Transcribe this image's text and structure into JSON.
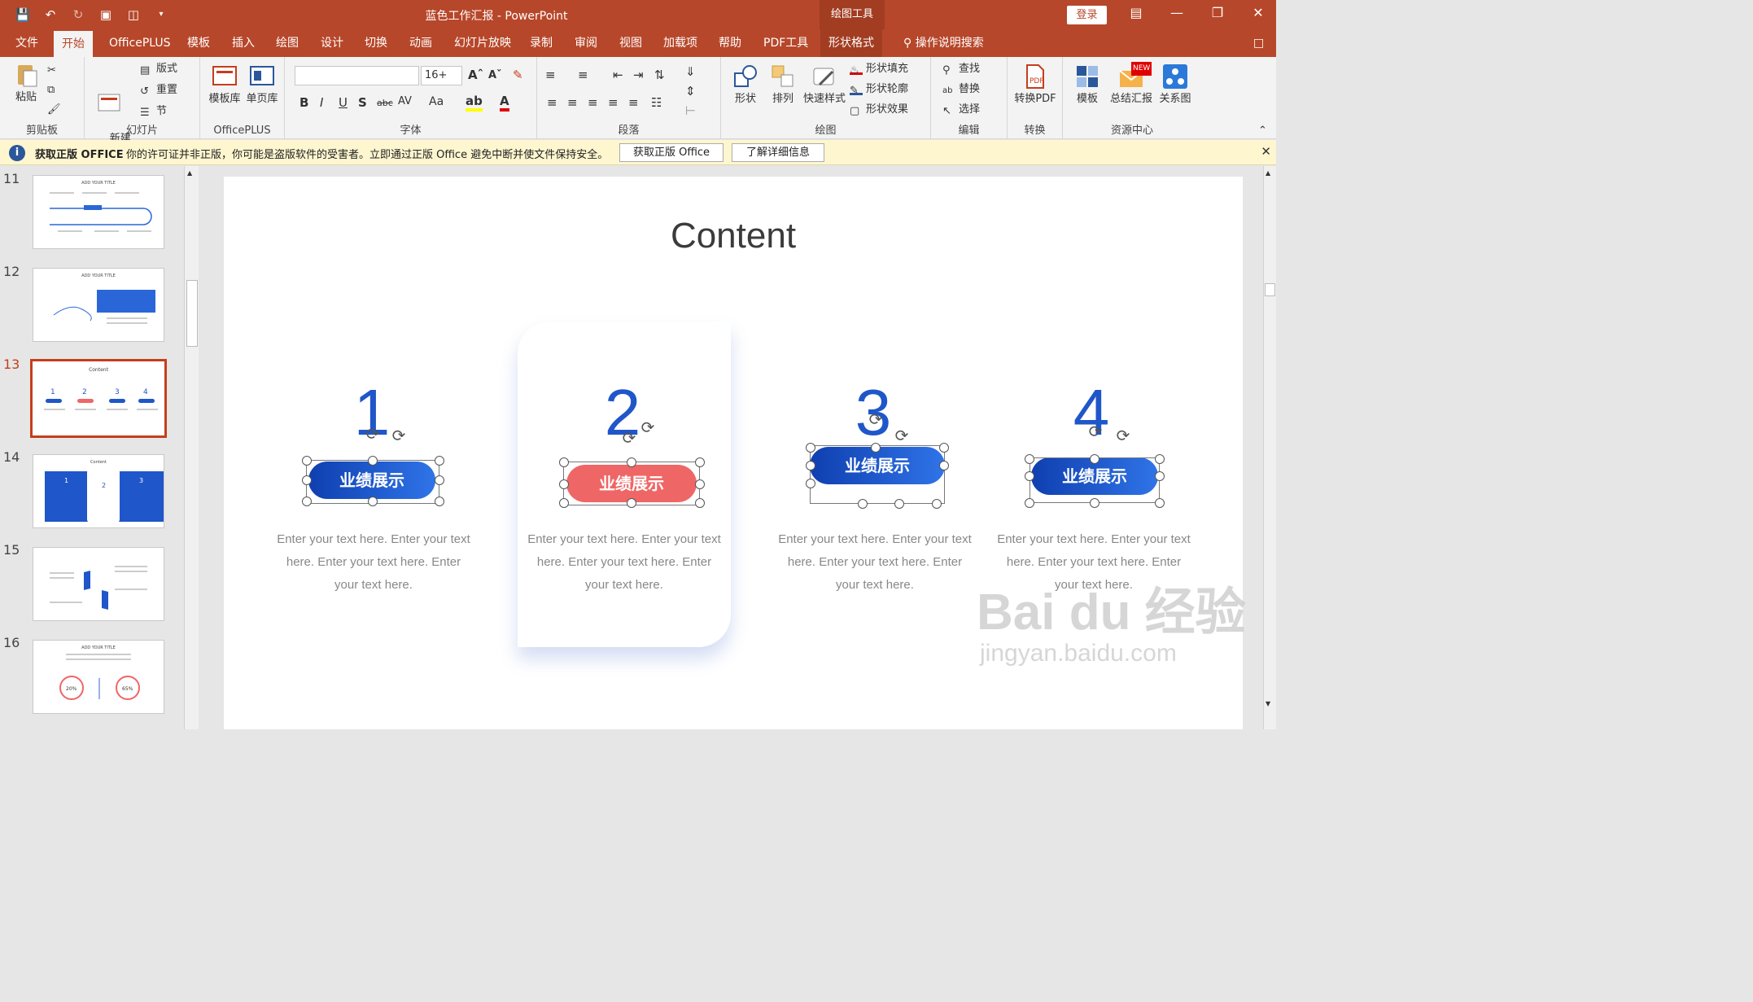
{
  "window": {
    "title": "蓝色工作汇报 - PowerPoint",
    "context_tab": "绘图工具",
    "login": "登录",
    "qat": [
      "save-icon",
      "undo-icon",
      "redo-icon",
      "present-icon",
      "layout-icon",
      "customize-icon"
    ],
    "controls": [
      "ribbon-display-icon",
      "minimize-icon",
      "maximize-icon",
      "close-icon"
    ]
  },
  "tabs": [
    "文件",
    "开始",
    "OfficePLUS",
    "模板",
    "插入",
    "绘图",
    "设计",
    "切换",
    "动画",
    "幻灯片放映",
    "录制",
    "审阅",
    "视图",
    "加载项",
    "帮助",
    "PDF工具",
    "形状格式"
  ],
  "tell_me": "操作说明搜索",
  "ribbon": {
    "clipboard": {
      "label": "剪贴板",
      "paste": "粘贴"
    },
    "slides": {
      "label": "幻灯片",
      "new_slide": "新建\n幻灯片",
      "layout": "版式",
      "reset": "重置",
      "section": "节"
    },
    "officeplus": {
      "label": "OfficePLUS",
      "lib": "模板库",
      "single": "单页库"
    },
    "font": {
      "label": "字体",
      "name": "",
      "size": "16+"
    },
    "paragraph": {
      "label": "段落"
    },
    "drawing": {
      "label": "绘图",
      "shape": "形状",
      "arrange": "排列",
      "quick_style": "快速样式",
      "fill": "形状填充",
      "outline": "形状轮廓",
      "effect": "形状效果"
    },
    "editing": {
      "label": "编辑",
      "find": "查找",
      "replace": "替换",
      "select": "选择"
    },
    "convert": {
      "label": "转换",
      "to_pdf": "转换PDF"
    },
    "resources": {
      "label": "资源中心",
      "template": "模板",
      "summary": "总结汇报",
      "relation": "关系图",
      "new_badge": "NEW"
    }
  },
  "message_bar": {
    "title": "获取正版 OFFICE",
    "text": "你的许可证并非正版，你可能是盗版软件的受害者。立即通过正版 Office 避免中断并使文件保持安全。",
    "btn1": "获取正版 Office",
    "btn2": "了解详细信息"
  },
  "thumbnails": [
    {
      "num": "11",
      "title": "ADD YOUR TITLE"
    },
    {
      "num": "12",
      "title": "ADD YOUR TITLE"
    },
    {
      "num": "13",
      "title": "Content"
    },
    {
      "num": "14",
      "title": "Content"
    },
    {
      "num": "15",
      "title": ""
    },
    {
      "num": "16",
      "title": "ADD YOUR TITLE",
      "p1": "20%",
      "p2": "65%"
    }
  ],
  "slide": {
    "title": "Content",
    "items": [
      {
        "num": "1",
        "pill": "业绩展示",
        "text": "Enter your text here. Enter your text here. Enter your text here. Enter your text here.",
        "color": "#1f56c9"
      },
      {
        "num": "2",
        "pill": "业绩展示",
        "text": "Enter your text here. Enter your text here. Enter your text here. Enter your text here.",
        "color": "#ef6666"
      },
      {
        "num": "3",
        "pill": "业绩展示",
        "text": "Enter your text here. Enter your text here. Enter your text here. Enter your text here.",
        "color": "#1f56c9"
      },
      {
        "num": "4",
        "pill": "业绩展示",
        "text": "Enter your text here. Enter your text here. Enter your text here. Enter your text here.",
        "color": "#1f56c9"
      }
    ]
  },
  "watermark": {
    "main": "Bai du 经验",
    "sub": "jingyan.baidu.com"
  }
}
